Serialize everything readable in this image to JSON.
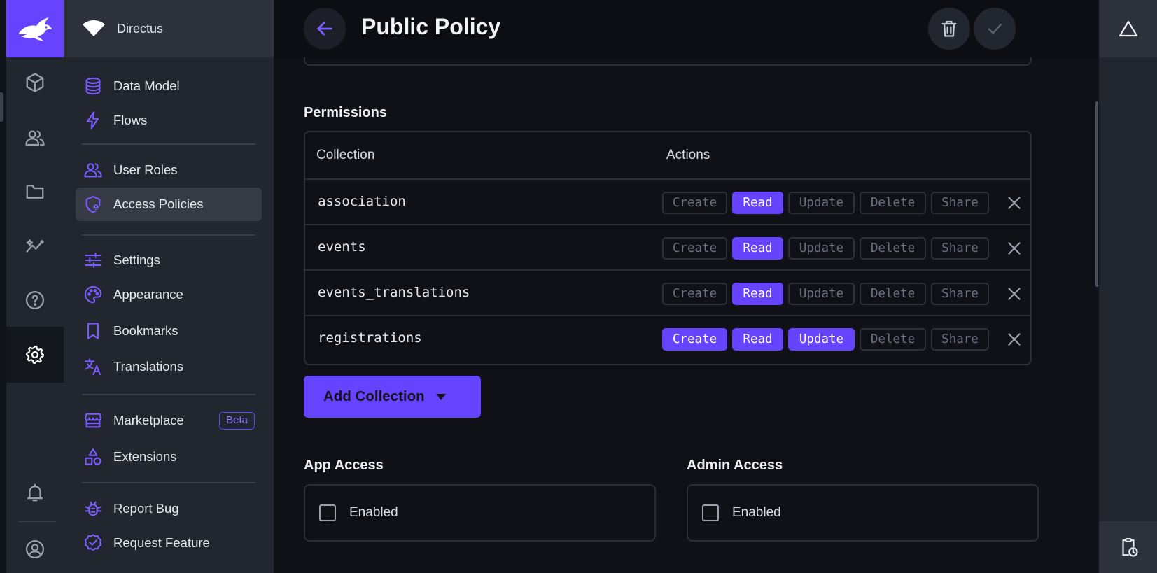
{
  "project": {
    "name": "Directus"
  },
  "module_bar": {
    "modules": [
      "cube-icon",
      "users-icon",
      "folder-icon",
      "insights-icon",
      "help-icon",
      "settings-icon",
      "bell-icon",
      "account-icon"
    ],
    "active": "settings-icon"
  },
  "nav": {
    "items": [
      {
        "label": "Data Model",
        "icon": "database-icon"
      },
      {
        "label": "Flows",
        "icon": "bolt-icon"
      },
      {
        "label": "User Roles",
        "icon": "group-icon"
      },
      {
        "label": "Access Policies",
        "icon": "policy-icon"
      },
      {
        "label": "Settings",
        "icon": "tune-icon"
      },
      {
        "label": "Appearance",
        "icon": "palette-icon"
      },
      {
        "label": "Bookmarks",
        "icon": "bookmark-icon"
      },
      {
        "label": "Translations",
        "icon": "translate-icon"
      },
      {
        "label": "Marketplace",
        "icon": "storefront-icon",
        "badge": "Beta"
      },
      {
        "label": "Extensions",
        "icon": "shapes-icon"
      },
      {
        "label": "Report Bug",
        "icon": "bug-icon"
      },
      {
        "label": "Request Feature",
        "icon": "verified-icon"
      }
    ],
    "active": "Access Policies"
  },
  "header": {
    "title": "Public Policy"
  },
  "permissions": {
    "section_label": "Permissions",
    "columns": [
      "Collection",
      "Actions"
    ],
    "action_labels": [
      "Create",
      "Read",
      "Update",
      "Delete",
      "Share"
    ],
    "rows": [
      {
        "collection": "association",
        "enabled": [
          false,
          true,
          false,
          false,
          false
        ]
      },
      {
        "collection": "events",
        "enabled": [
          false,
          true,
          false,
          false,
          false
        ]
      },
      {
        "collection": "events_translations",
        "enabled": [
          false,
          true,
          false,
          false,
          false
        ]
      },
      {
        "collection": "registrations",
        "enabled": [
          true,
          true,
          true,
          false,
          false
        ]
      }
    ],
    "add_button": "Add Collection"
  },
  "app_access": {
    "label": "App Access",
    "checkbox_label": "Enabled",
    "checked": false
  },
  "admin_access": {
    "label": "Admin Access",
    "checkbox_label": "Enabled",
    "checked": false
  },
  "colors": {
    "accent": "#6644ff",
    "background": "#0f1117",
    "sidebar": "#22262e"
  }
}
